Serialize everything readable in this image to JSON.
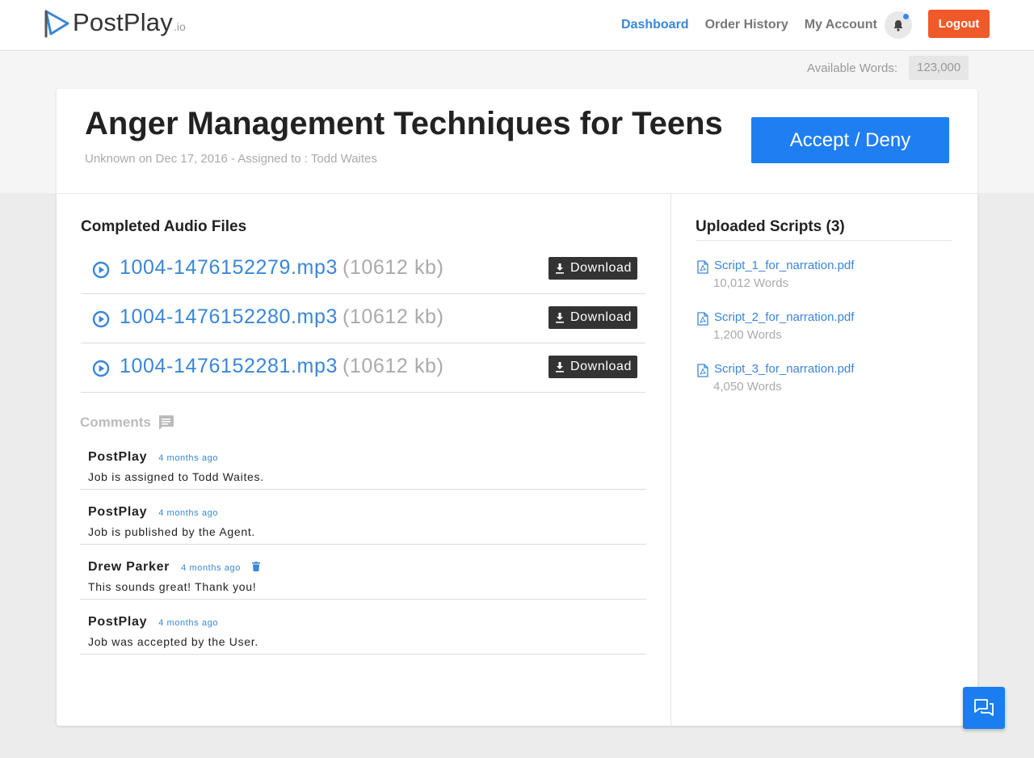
{
  "brand": {
    "name": "PostPlay",
    "suffix": ".io"
  },
  "nav": {
    "dashboard": "Dashboard",
    "order_history": "Order History",
    "my_account": "My Account",
    "logout": "Logout"
  },
  "account": {
    "available_words_label": "Available Words:",
    "available_words": "123,000"
  },
  "job": {
    "title": "Anger Management Techniques for Teens",
    "meta": "Unknown on Dec 17, 2016 - Assigned to : Todd Waites",
    "accept_deny_label": "Accept / Deny"
  },
  "audio": {
    "heading": "Completed Audio Files",
    "download_label": "Download",
    "files": [
      {
        "name": "1004-1476152279.mp3",
        "size": "(10612 kb)"
      },
      {
        "name": "1004-1476152280.mp3",
        "size": "(10612 kb)"
      },
      {
        "name": "1004-1476152281.mp3",
        "size": "(10612 kb)"
      }
    ]
  },
  "comments": {
    "heading": "Comments",
    "items": [
      {
        "author": "PostPlay",
        "time": "4 months ago",
        "text": "Job is assigned to Todd Waites."
      },
      {
        "author": "PostPlay",
        "time": "4 months ago",
        "text": "Job is published by the Agent."
      },
      {
        "author": "Drew Parker",
        "time": "4 months ago",
        "text": "This sounds great! Thank you!"
      },
      {
        "author": "PostPlay",
        "time": "4 months ago",
        "text": "Job was accepted by the User."
      }
    ]
  },
  "scripts": {
    "heading": "Uploaded Scripts (3)",
    "items": [
      {
        "name": "Script_1_for_narration.pdf",
        "words": "10,012 Words"
      },
      {
        "name": "Script_2_for_narration.pdf",
        "words": "1,200 Words"
      },
      {
        "name": "Script_3_for_narration.pdf",
        "words": "4,050 Words"
      }
    ]
  },
  "icons": {
    "logo": "play-triangle-logo-icon",
    "notifications": "bell-icon",
    "play": "play-circle-icon",
    "download": "download-icon",
    "comments": "comment-bubble-icon",
    "delete": "trash-icon",
    "pdf": "pdf-file-icon",
    "chat": "chat-icon"
  },
  "colors": {
    "link": "#3a86d8",
    "logout": "#f05a28",
    "primary_button": "#1f7ef2",
    "chat_button": "#1a7ef0"
  }
}
